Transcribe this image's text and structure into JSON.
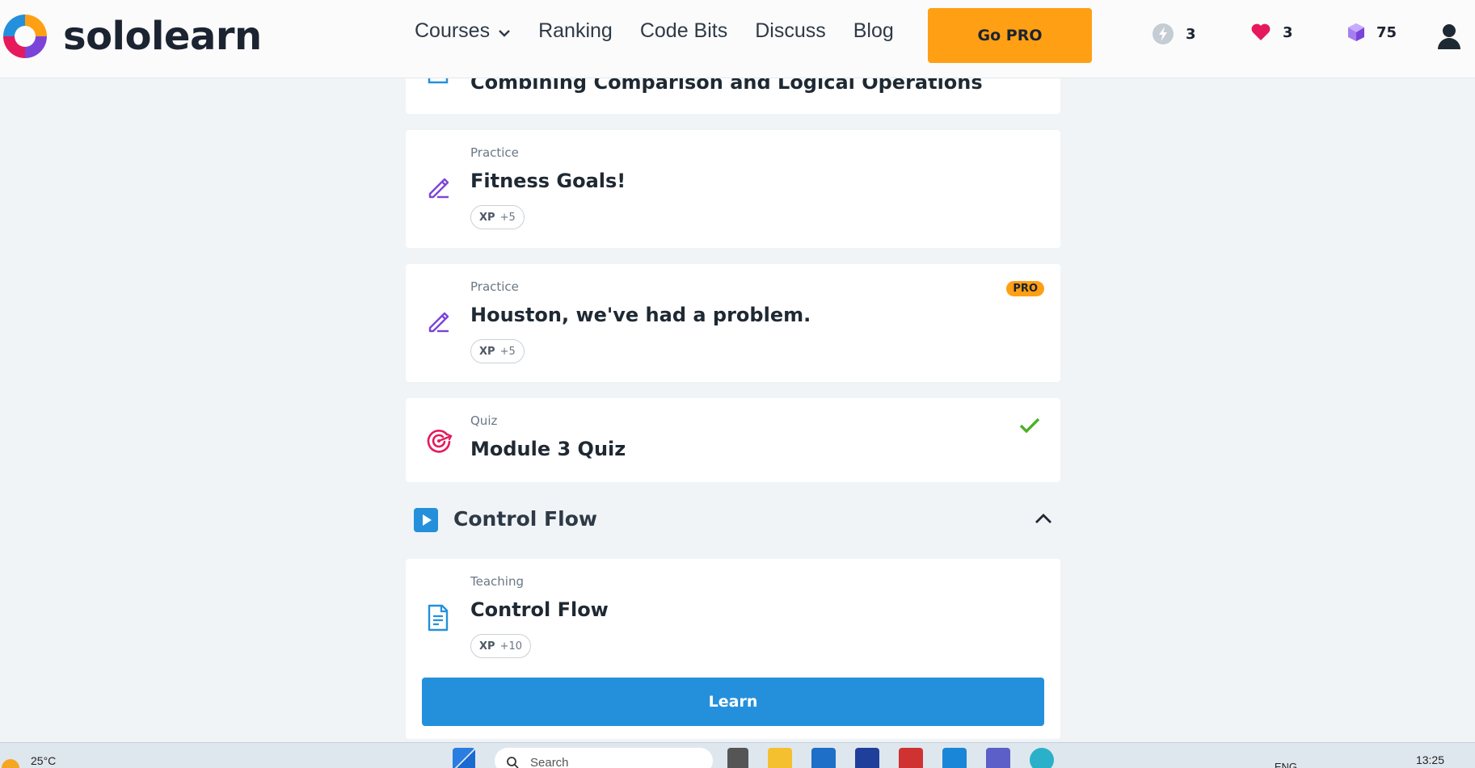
{
  "brand": {
    "name": "sololearn",
    "colors": {
      "primary_blue": "#2490dc",
      "pro_orange": "#ff9f14",
      "practice_purple": "#7b44d9",
      "quiz_pink": "#e6195c",
      "check_green": "#4caf29"
    }
  },
  "nav": {
    "items": [
      {
        "label": "Courses",
        "has_dropdown": true
      },
      {
        "label": "Ranking"
      },
      {
        "label": "Code Bits"
      },
      {
        "label": "Discuss"
      },
      {
        "label": "Blog"
      }
    ],
    "gopro_label": "Go PRO",
    "stats": {
      "streak": "3",
      "hearts": "3",
      "bits": "75"
    }
  },
  "lessons": {
    "top_partial": {
      "title": "Combining Comparison and Logical Operations",
      "icon": "teaching-icon"
    },
    "fitness": {
      "kind": "Practice",
      "title": "Fitness Goals!",
      "xp_label": "XP",
      "xp_value": "+5",
      "icon": "practice-pencil-icon"
    },
    "houston": {
      "kind": "Practice",
      "title": "Houston, we've had a problem.",
      "xp_label": "XP",
      "xp_value": "+5",
      "badge": "PRO",
      "icon": "practice-pencil-icon"
    },
    "quiz": {
      "kind": "Quiz",
      "title": "Module 3 Quiz",
      "completed": true,
      "icon": "quiz-target-icon"
    }
  },
  "section": {
    "title": "Control Flow",
    "expanded": true,
    "lesson": {
      "kind": "Teaching",
      "title": "Control Flow",
      "xp_label": "XP",
      "xp_value": "+10",
      "button": "Learn",
      "icon": "teaching-icon"
    }
  },
  "taskbar": {
    "weather": "25°C",
    "search_placeholder": "Search",
    "lang": "ENG",
    "time": "13:25"
  }
}
